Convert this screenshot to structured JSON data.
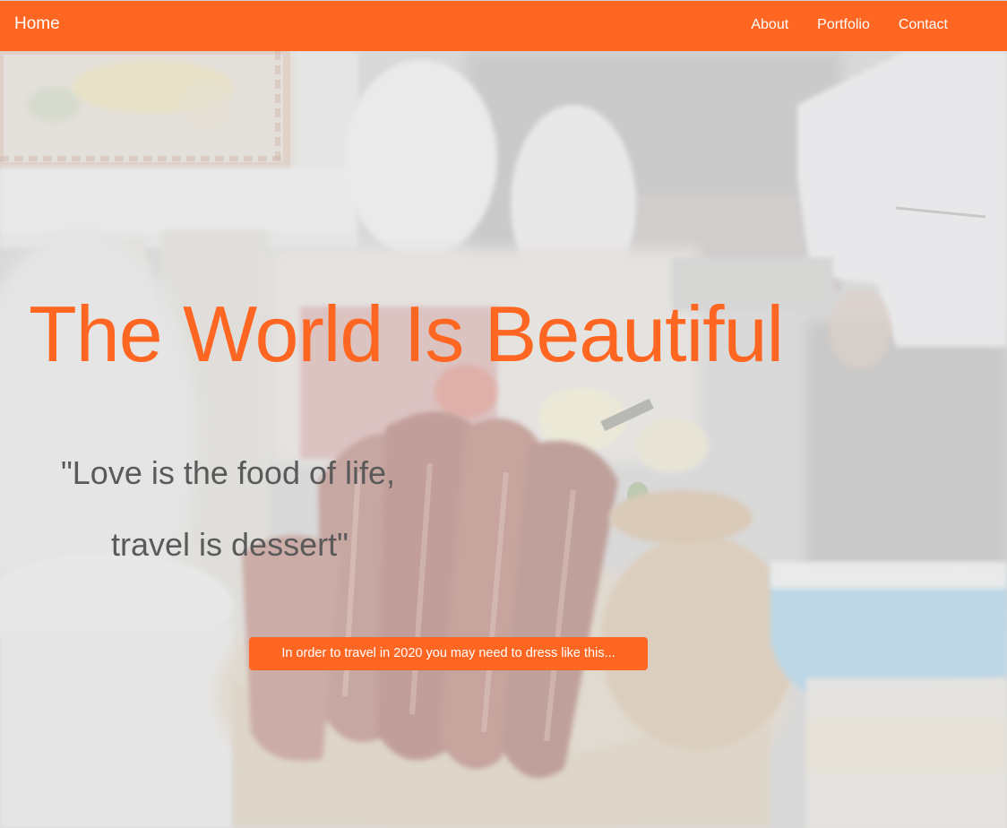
{
  "navbar": {
    "home_label": "Home",
    "links": [
      {
        "label": "About"
      },
      {
        "label": "Portfolio"
      },
      {
        "label": "Contact"
      }
    ]
  },
  "hero": {
    "title": "The World Is Beautiful",
    "quote_line_1": "\"Love is the food of life,",
    "quote_line_2": "travel is dessert\"",
    "cta_label": "In order to travel in 2020 you may need to dress like this..."
  },
  "colors": {
    "accent": "#ff6622",
    "quote_text": "#5a5a5a",
    "nav_text": "#ffffff"
  }
}
